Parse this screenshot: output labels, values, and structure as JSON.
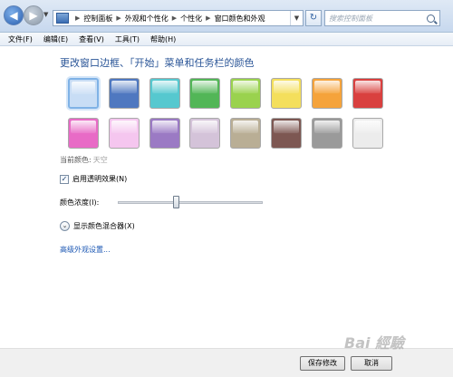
{
  "toolbar": {
    "breadcrumbs": [
      "控制面板",
      "外观和个性化",
      "个性化",
      "窗口颜色和外观"
    ],
    "search_placeholder": "搜索控制面板"
  },
  "menu": [
    "文件(F)",
    "编辑(E)",
    "查看(V)",
    "工具(T)",
    "帮助(H)"
  ],
  "heading": "更改窗口边框、「开始」菜单和任务栏的颜色",
  "swatches": {
    "selected_index": 0,
    "colors": [
      "#c8ddf5",
      "#4f78c0",
      "#56c8cf",
      "#52b657",
      "#9ad24e",
      "#f4df5c",
      "#f5a33b",
      "#d9403f",
      "#e86bc6",
      "#f5c6ef",
      "#9b7ac4",
      "#d4c3d9",
      "#b9ae95",
      "#7d5752",
      "#9a9a9a",
      "#ececec"
    ]
  },
  "current_color": {
    "label": "当前颜色:",
    "value": "天空"
  },
  "transparency": {
    "label": "启用透明效果(N)",
    "checked": true
  },
  "intensity": {
    "label": "颜色浓度(I):",
    "value_fraction": 0.4
  },
  "mixer": {
    "label": "显示颜色混合器(X)"
  },
  "advanced_link": "高级外观设置...",
  "buttons": {
    "save": "保存修改",
    "cancel": "取消"
  },
  "watermark": "Bai 经验"
}
